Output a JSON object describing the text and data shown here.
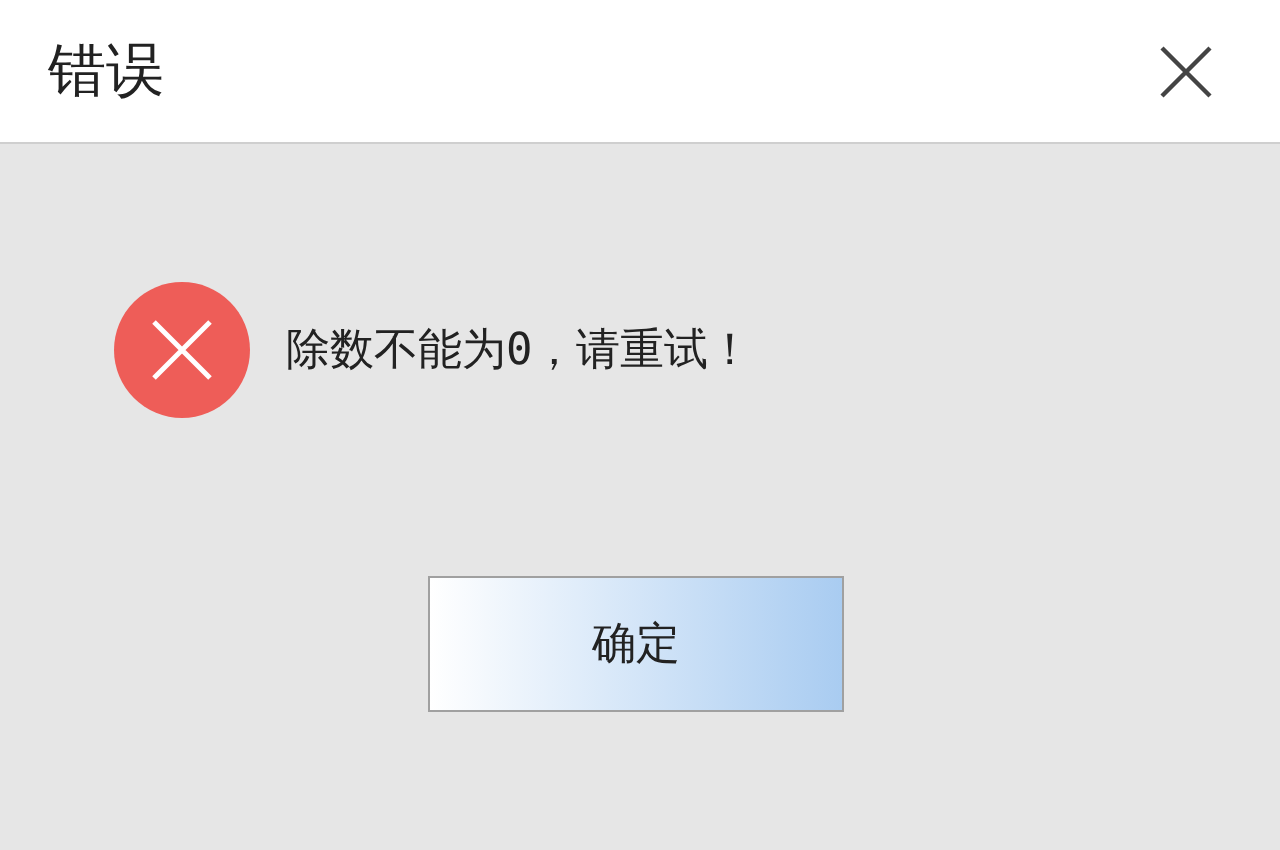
{
  "window": {
    "title": "错误"
  },
  "message": {
    "text": "除数不能为0，请重试！"
  },
  "buttons": [
    "确定"
  ]
}
